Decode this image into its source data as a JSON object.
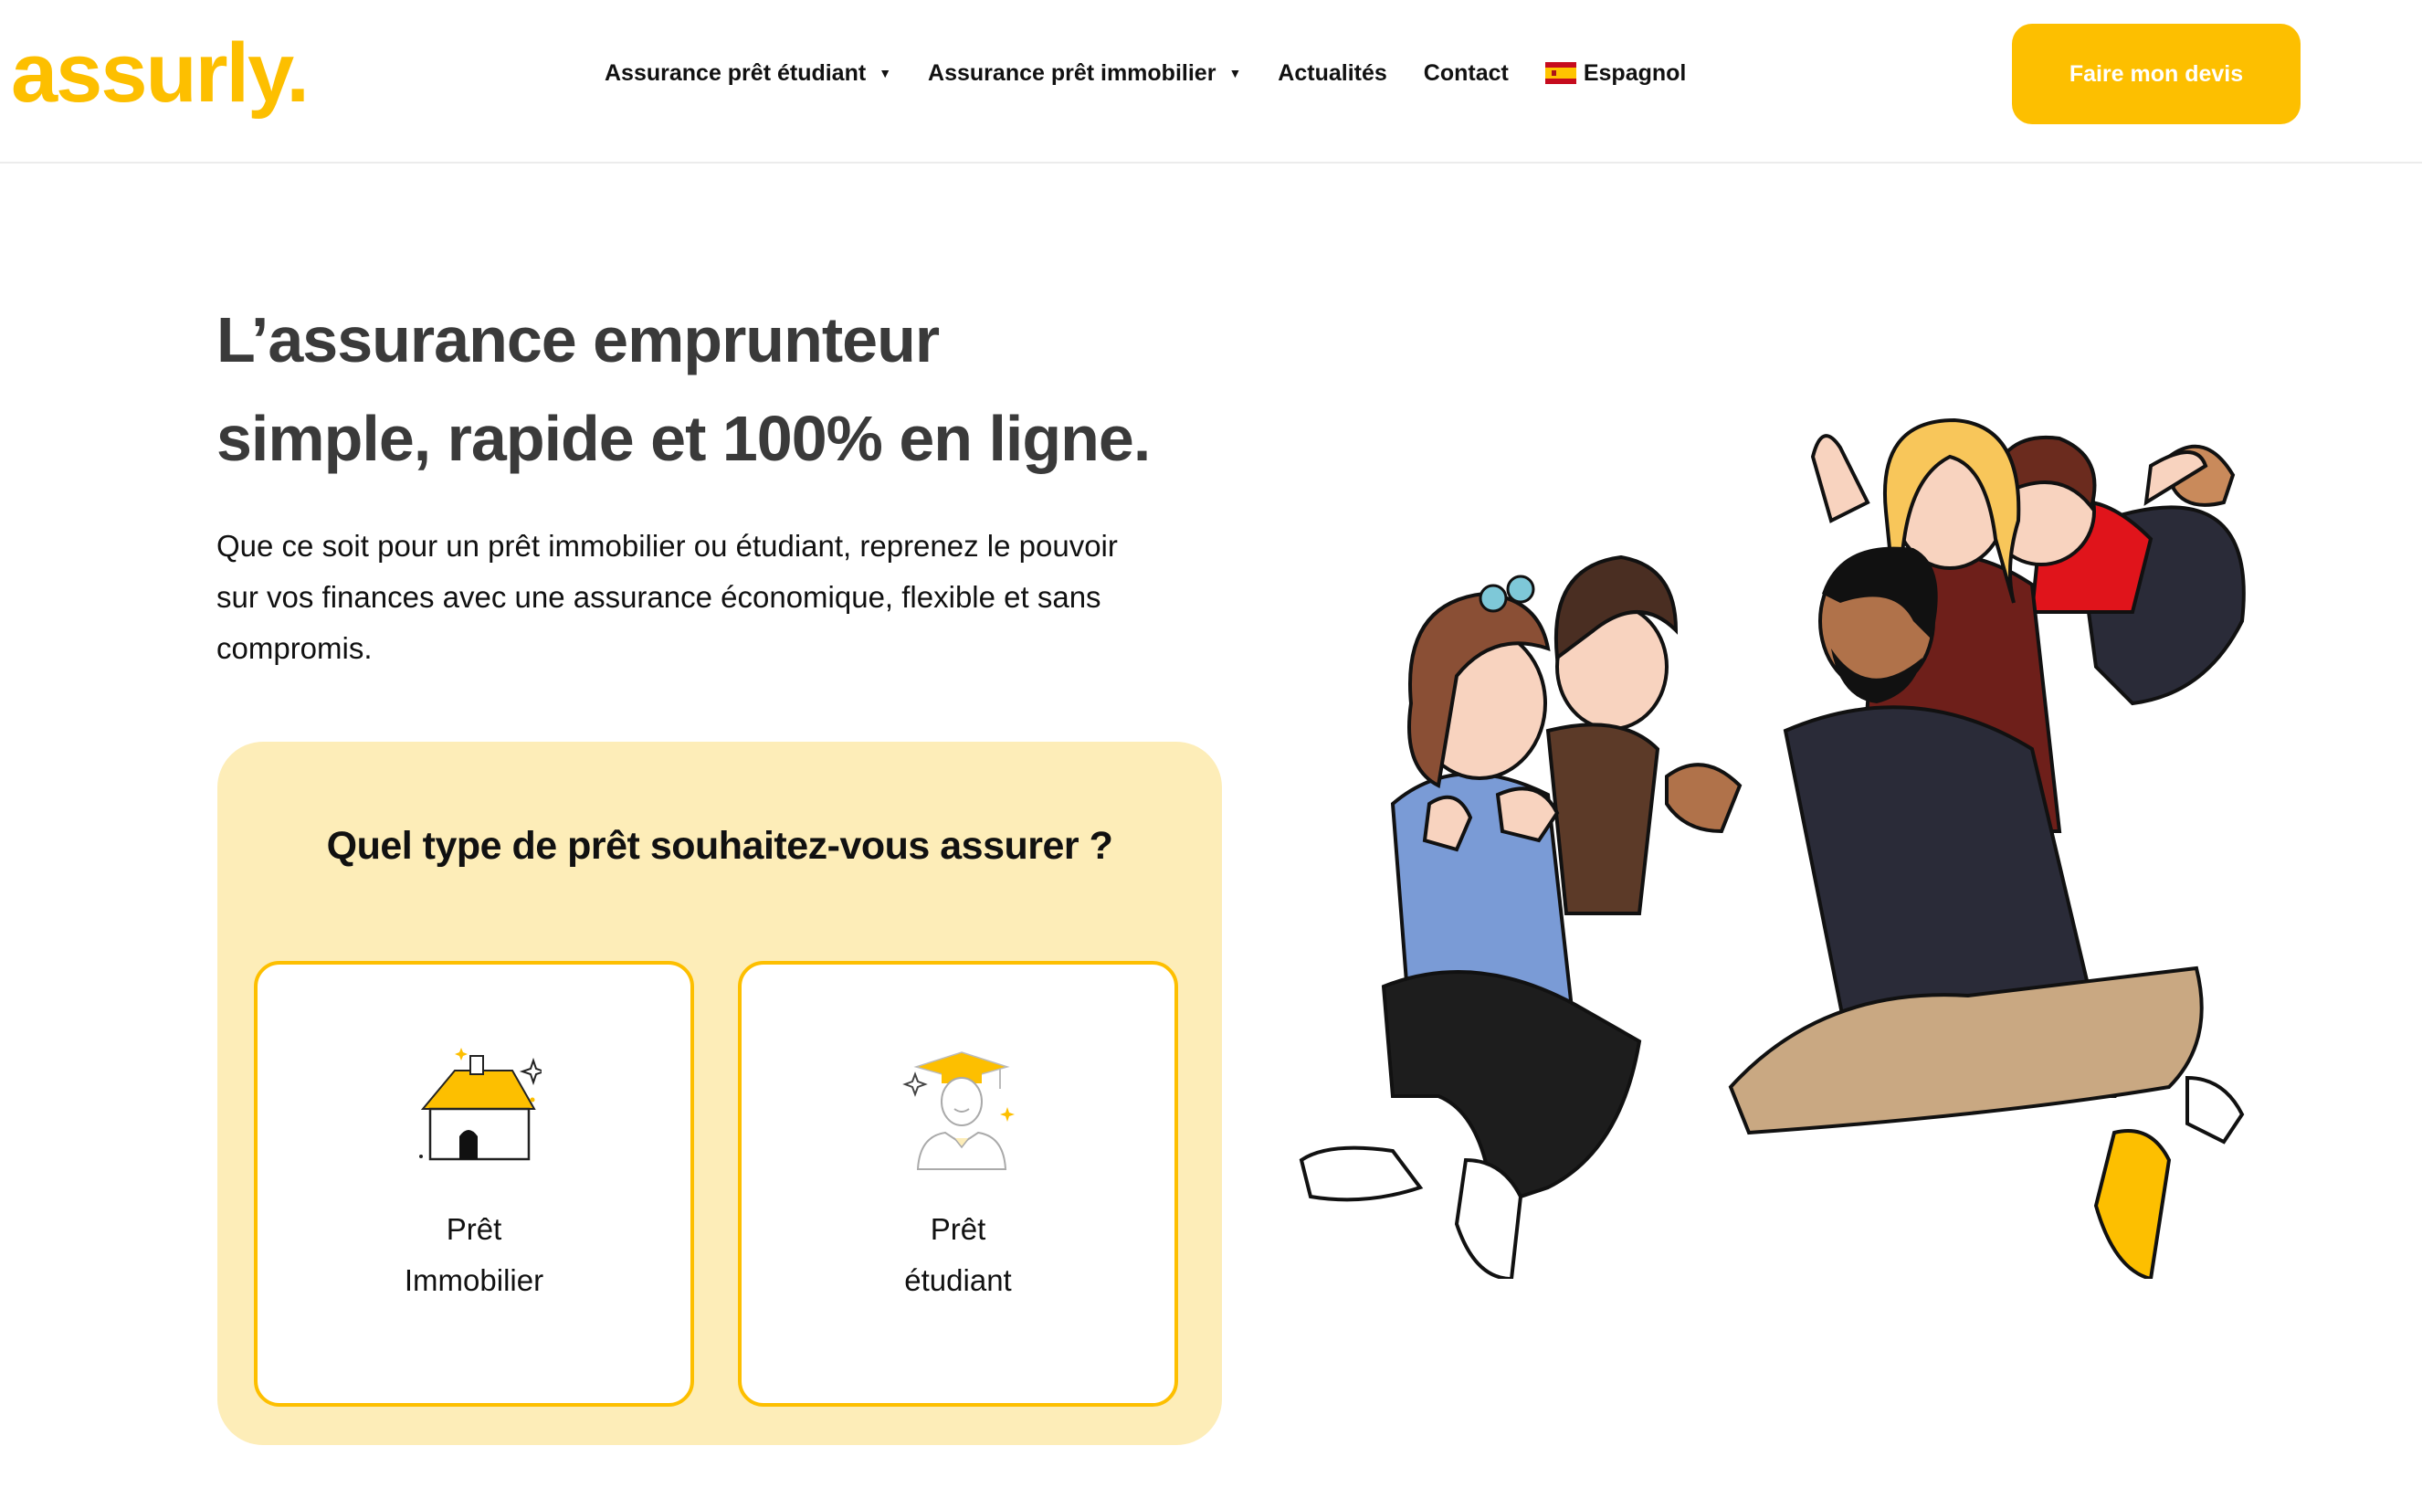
{
  "header": {
    "logo": "assurly.",
    "nav": [
      {
        "label": "Assurance prêt étudiant",
        "has_dropdown": true
      },
      {
        "label": "Assurance prêt immobilier",
        "has_dropdown": true
      },
      {
        "label": "Actualités",
        "has_dropdown": false
      },
      {
        "label": "Contact",
        "has_dropdown": false
      },
      {
        "label": "Espagnol",
        "icon": "spain-flag-icon"
      }
    ],
    "cta_label": "Faire mon devis"
  },
  "hero": {
    "headline_line1": "L’assurance emprunteur",
    "headline_line2": "simple, rapide et 100% en ligne.",
    "intro_line1": "Que ce soit pour un prêt immobilier ou étudiant, reprenez le pouvoir",
    "intro_line2": "sur vos finances avec une assurance économique, flexible et sans",
    "intro_line3": "compromis."
  },
  "loan_picker": {
    "title": "Quel type de prêt souhaitez-vous assurer ?",
    "options": [
      {
        "line1": "Prêt",
        "line2": "Immobilier",
        "icon": "house-icon"
      },
      {
        "line1": "Prêt",
        "line2": "étudiant",
        "icon": "graduate-icon"
      }
    ]
  },
  "colors": {
    "brand": "#FDBF00",
    "panel": "#FDEDB8",
    "heading": "#3a3a3a"
  }
}
